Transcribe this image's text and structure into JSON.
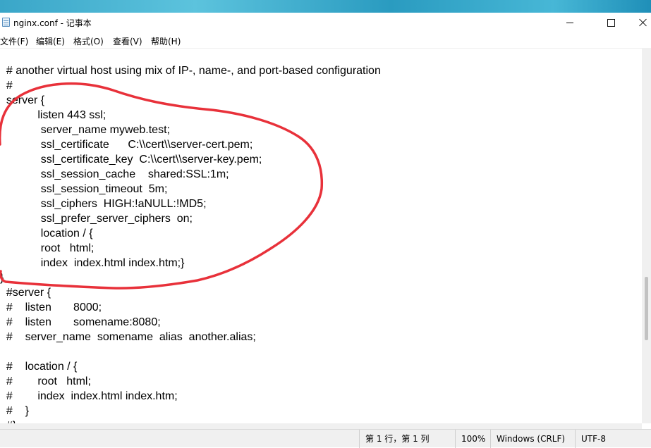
{
  "window": {
    "title": "nginx.conf - 记事本",
    "minimize_label": "",
    "maximize_label": "",
    "close_label": ""
  },
  "menu": {
    "items": [
      "文件(F)",
      "编辑(E)",
      "格式(O)",
      "查看(V)",
      "帮助(H)"
    ]
  },
  "editor": {
    "lines": [
      "  # another virtual host using mix of IP-, name-, and port-based configuration",
      "  #",
      "  server {",
      "            listen 443 ssl;",
      "             server_name myweb.test;",
      "             ssl_certificate      C:\\\\cert\\\\server-cert.pem;",
      "             ssl_certificate_key  C:\\\\cert\\\\server-key.pem;",
      "             ssl_session_cache    shared:SSL:1m;",
      "             ssl_session_timeout  5m;",
      "             ssl_ciphers  HIGH:!aNULL:!MD5;",
      "             ssl_prefer_server_ciphers  on;",
      "             location / {",
      "             root   html;",
      "             index  index.html index.htm;}",
      "}",
      "  #server {",
      "  #    listen       8000;",
      "  #    listen       somename:8080;",
      "  #    server_name  somename  alias  another.alias;",
      "",
      "  #    location / {",
      "  #        root   html;",
      "  #        index  index.html index.htm;",
      "  #    }",
      "  #}"
    ]
  },
  "statusbar": {
    "position": "第 1 行，第 1 列",
    "zoom": "100%",
    "line_ending": "Windows (CRLF)",
    "encoding": "UTF-8"
  },
  "colors": {
    "annotation_stroke": "#e8313a",
    "desktop_accent": "#3aa6c8"
  },
  "icons": {
    "app": "notepad-icon",
    "minimize": "minimize-icon",
    "maximize": "maximize-icon",
    "close": "close-icon"
  }
}
